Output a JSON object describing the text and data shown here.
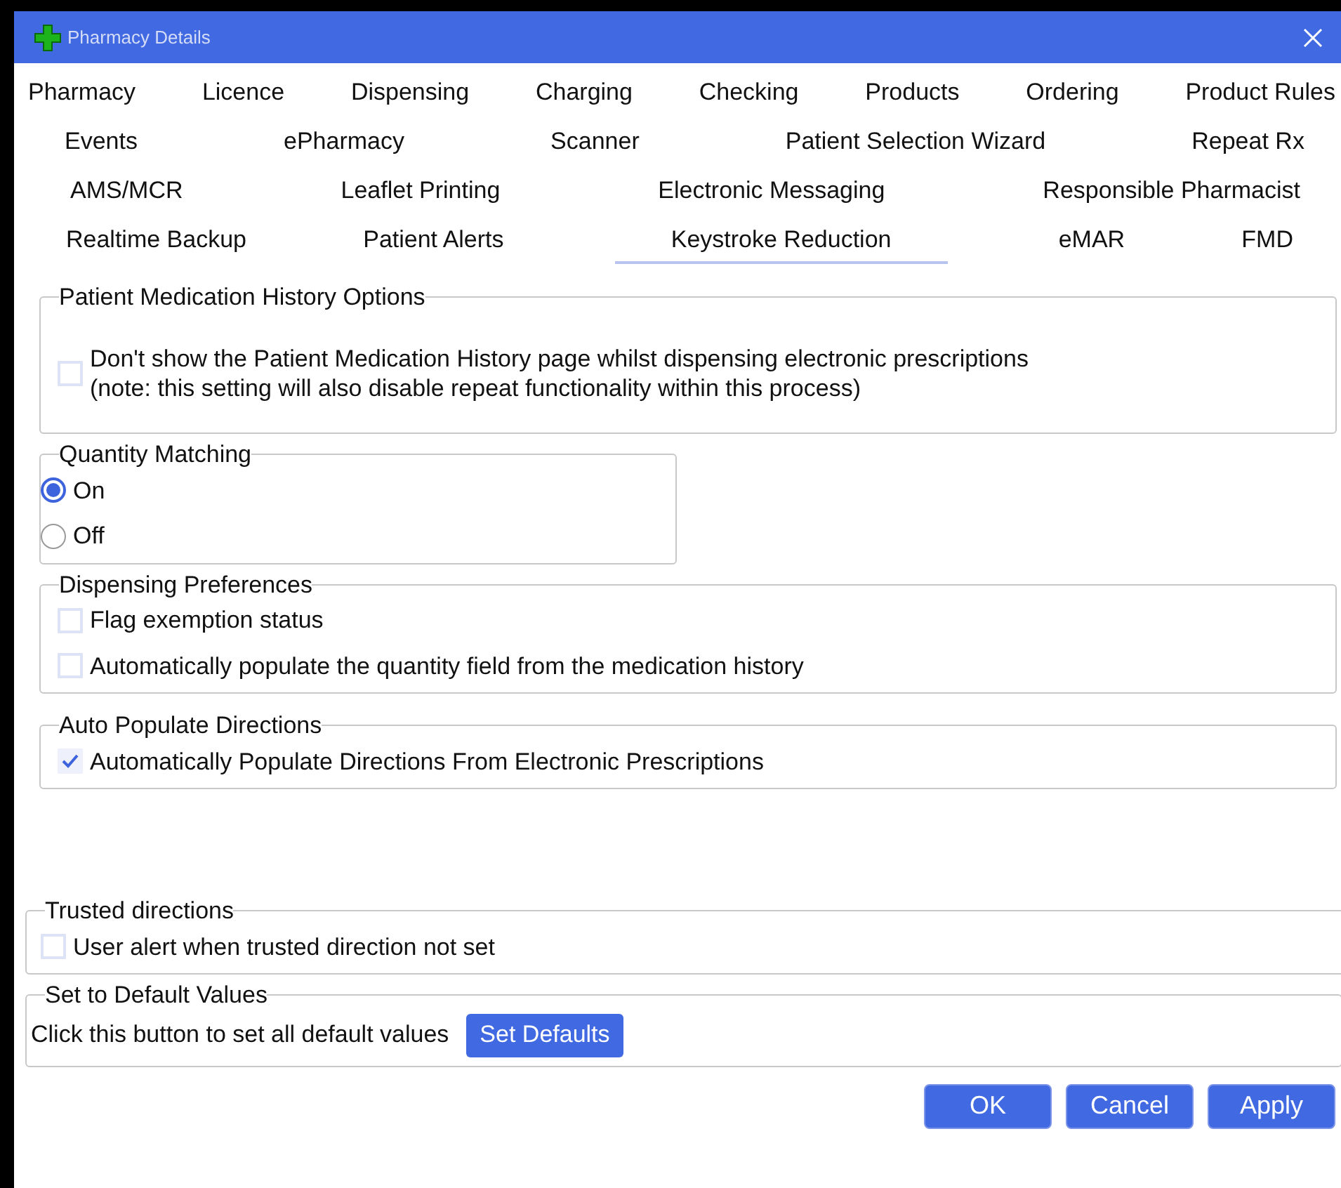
{
  "window": {
    "title": "Pharmacy Details"
  },
  "tab_rows": [
    [
      {
        "label": "Pharmacy",
        "selected": false
      },
      {
        "label": "Licence",
        "selected": false
      },
      {
        "label": "Dispensing",
        "selected": false
      },
      {
        "label": "Charging",
        "selected": false
      },
      {
        "label": "Checking",
        "selected": false
      },
      {
        "label": "Products",
        "selected": false
      },
      {
        "label": "Ordering",
        "selected": false
      },
      {
        "label": "Product Rules",
        "selected": false
      }
    ],
    [
      {
        "label": "Events",
        "selected": false
      },
      {
        "label": "ePharmacy",
        "selected": false
      },
      {
        "label": "Scanner",
        "selected": false
      },
      {
        "label": "Patient Selection Wizard",
        "selected": false
      },
      {
        "label": "Repeat Rx",
        "selected": false
      }
    ],
    [
      {
        "label": "AMS/MCR",
        "selected": false
      },
      {
        "label": "Leaflet Printing",
        "selected": false
      },
      {
        "label": "Electronic Messaging",
        "selected": false
      },
      {
        "label": "Responsible Pharmacist",
        "selected": false
      }
    ],
    [
      {
        "label": "Realtime Backup",
        "selected": false
      },
      {
        "label": "Patient Alerts",
        "selected": false
      },
      {
        "label": "Keystroke Reduction",
        "selected": true
      },
      {
        "label": "eMAR",
        "selected": false
      },
      {
        "label": "FMD",
        "selected": false
      }
    ]
  ],
  "groups": [
    {
      "title": "Patient Medication History Options",
      "items": [
        {
          "kind": "checkbox",
          "label": "Don't show the Patient Medication History page whilst dispensing electronic prescriptions",
          "note": "(note: this setting will also disable repeat functionality within this process)",
          "checked": false
        }
      ]
    },
    {
      "title": "Quantity Matching",
      "items": [
        {
          "kind": "radio",
          "label": "On",
          "selected": true
        },
        {
          "kind": "radio",
          "label": "Off",
          "selected": false
        }
      ]
    },
    {
      "title": "Dispensing Preferences",
      "items": [
        {
          "kind": "checkbox",
          "label": "Flag exemption status",
          "checked": false
        },
        {
          "kind": "checkbox",
          "label": "Automatically populate the quantity field from the medication history",
          "checked": false
        }
      ]
    },
    {
      "title": "Auto Populate Directions",
      "items": [
        {
          "kind": "checkbox",
          "label": "Automatically Populate Directions From Electronic Prescriptions",
          "checked": true
        }
      ]
    },
    {
      "title": "Trusted directions",
      "items": [
        {
          "kind": "checkbox",
          "label": "User alert when trusted direction not set",
          "checked": false
        }
      ]
    },
    {
      "title": "Set to Default Values",
      "items": [
        {
          "kind": "action",
          "label": "Click this button to set all default values",
          "button": "Set Defaults"
        }
      ]
    }
  ],
  "buttons": [
    "OK",
    "Cancel",
    "Apply"
  ]
}
